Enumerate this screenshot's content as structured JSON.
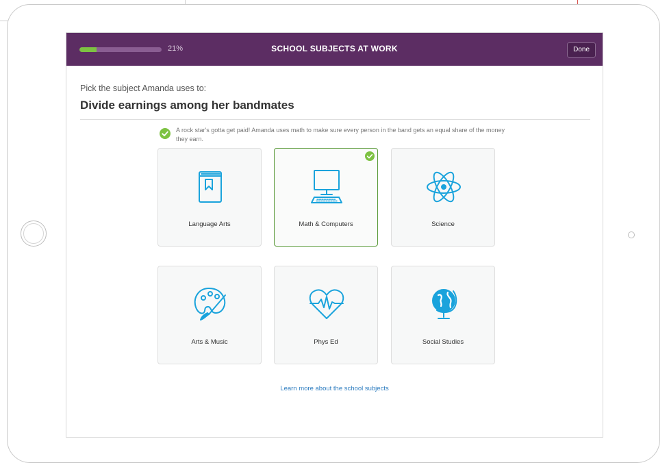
{
  "header": {
    "progress_percent": 21,
    "progress_text": "21%",
    "title": "SCHOOL SUBJECTS AT WORK",
    "done_label": "Done"
  },
  "prompt": "Pick the subject Amanda uses to:",
  "question": "Divide earnings among her bandmates",
  "feedback": "A rock star's gotta get paid! Amanda uses math to make sure every person in the band gets an equal share of the money they earn.",
  "subjects": [
    {
      "label": "Language Arts",
      "icon": "book-icon",
      "selected": false
    },
    {
      "label": "Math & Computers",
      "icon": "computer-icon",
      "selected": true
    },
    {
      "label": "Science",
      "icon": "atom-icon",
      "selected": false
    },
    {
      "label": "Arts & Music",
      "icon": "palette-icon",
      "selected": false
    },
    {
      "label": "Phys Ed",
      "icon": "heartbeat-icon",
      "selected": false
    },
    {
      "label": "Social Studies",
      "icon": "globe-icon",
      "selected": false
    }
  ],
  "learn_more": "Learn more about the school subjects",
  "colors": {
    "header_bg": "#5c2d63",
    "accent_green": "#7dc242",
    "icon_blue": "#1aa3dc",
    "link_blue": "#2b7bbf"
  }
}
